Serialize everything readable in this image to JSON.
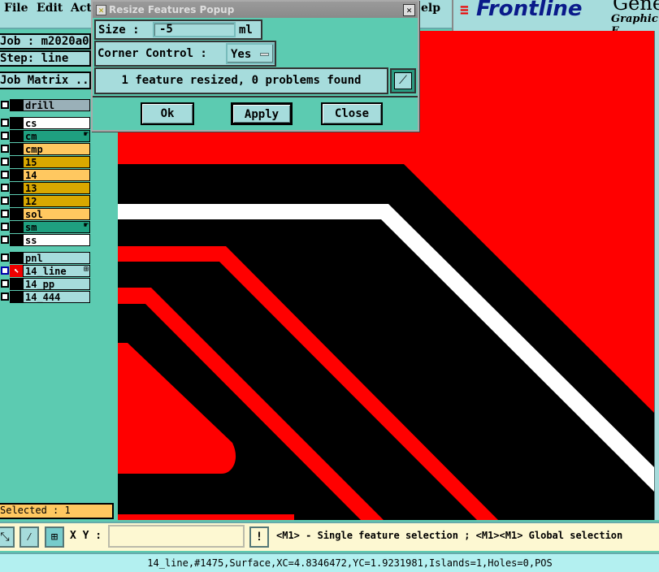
{
  "menu": {
    "file": "File",
    "edit": "Edit",
    "actions": "Act",
    "help": "elp"
  },
  "logo": {
    "brand": "Frontline",
    "product": "Genesis",
    "subtitle": "Graphic E"
  },
  "job": {
    "job_label": "Job : m2020a0",
    "step_label": "Step: line",
    "matrix_button": "Job Matrix .."
  },
  "layers": [
    {
      "name": "drill",
      "color": "#9ab0b8"
    },
    {
      "name": "cs",
      "color": "#ffffff"
    },
    {
      "name": "cm",
      "color": "#1fa080",
      "mark": "☛"
    },
    {
      "name": "cmp",
      "color": "#ffc860"
    },
    {
      "name": "15",
      "color": "#d9a800"
    },
    {
      "name": "14",
      "color": "#ffc860"
    },
    {
      "name": "13",
      "color": "#d9a800"
    },
    {
      "name": "12",
      "color": "#d9a800"
    },
    {
      "name": "sol",
      "color": "#ffc860"
    },
    {
      "name": "sm",
      "color": "#1fa080",
      "mark": "☛"
    },
    {
      "name": "ss",
      "color": "#ffffff"
    },
    {
      "name": "pnl",
      "color": "#a6dcdc"
    },
    {
      "name": "14_line",
      "color": "#a6dcdc",
      "mark": "⊞",
      "active": true
    },
    {
      "name": "14_pp",
      "color": "#a6dcdc"
    },
    {
      "name": "14_444",
      "color": "#a6dcdc"
    }
  ],
  "selected": "Selected : 1",
  "dialog": {
    "title": "Resize Features Popup",
    "size_label": "Size :",
    "size_value": "-5",
    "size_unit": "ml",
    "corner_label": "Corner Control :",
    "corner_value": "Yes",
    "message": "1 feature resized, 0 problems found",
    "ok": "Ok",
    "apply": "Apply",
    "close": "Close"
  },
  "toolbar": {
    "xy_label": "X Y :",
    "xy_value": "",
    "hint": "<M1> - Single feature selection ; <M1><M1> Global selection"
  },
  "status": "14_line,#1475,Surface,XC=4.8346472,YC=1.9231981,Islands=1,Holes=0,POS"
}
